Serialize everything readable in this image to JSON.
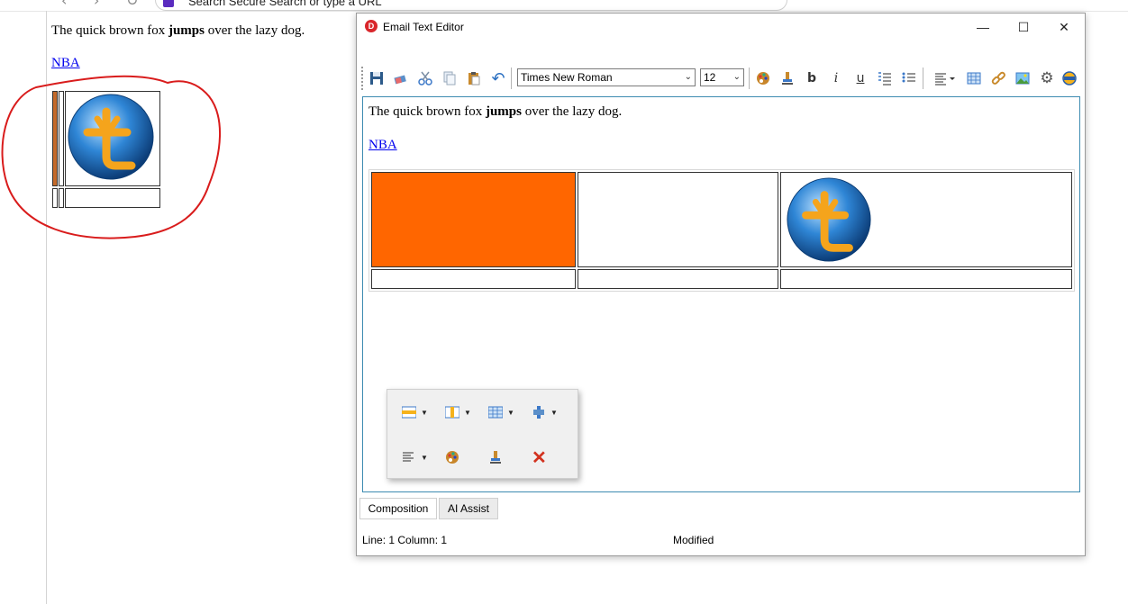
{
  "browser": {
    "address_text": "Search Secure Search or type a URL"
  },
  "preview": {
    "text_before": "The quick brown fox ",
    "text_bold": "jumps",
    "text_after": " over the lazy dog.",
    "link_text": "NBA"
  },
  "window": {
    "app_icon_letter": "D",
    "title": "Email Text Editor",
    "minimize_glyph": "—",
    "maximize_glyph": "☐",
    "close_glyph": "✕"
  },
  "toolbar": {
    "font_family": "Times New Roman",
    "font_size": "12",
    "bold_label": "b",
    "italic_label": "i",
    "underline_label": "u",
    "icons": [
      "save-icon",
      "eraser-icon",
      "cut-icon",
      "copy-icon",
      "paste-icon",
      "undo-icon",
      "palette-icon",
      "highlighter-icon",
      "bold-icon",
      "italic-icon",
      "underline-icon",
      "numbered-list-icon",
      "bullet-list-icon",
      "align-icon",
      "table-icon",
      "link-icon",
      "image-icon",
      "settings-icon",
      "html-icon"
    ]
  },
  "editor": {
    "text_before": "The quick brown fox ",
    "text_bold": "jumps",
    "text_after": " over the lazy dog.",
    "link_text": "NBA",
    "orange_cell_color": "#ff6600"
  },
  "context_menu": {
    "items": [
      "insert-row-icon",
      "insert-column-icon",
      "cell-properties-icon",
      "merge-cells-icon",
      "align-icon",
      "palette-icon",
      "highlighter-icon",
      "delete-icon"
    ]
  },
  "tabs": [
    {
      "label": "Composition",
      "active": true
    },
    {
      "label": "AI Assist",
      "active": false
    }
  ],
  "status": {
    "position": "Line: 1 Column: 1",
    "state": "Modified"
  },
  "colors": {
    "accent": "#3d8bb1",
    "annotation": "#d91c1c",
    "link": "#0000ee"
  }
}
